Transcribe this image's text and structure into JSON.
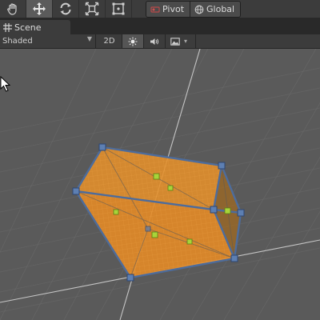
{
  "toolbar": {
    "tools": [
      {
        "name": "hand-tool",
        "icon": "hand-icon",
        "active": false
      },
      {
        "name": "move-tool",
        "icon": "move-arrows-icon",
        "active": true
      },
      {
        "name": "rotate-tool",
        "icon": "rotate-icon",
        "active": false
      },
      {
        "name": "scale-tool",
        "icon": "scale-icon",
        "active": false
      },
      {
        "name": "rect-tool",
        "icon": "rect-transform-icon",
        "active": false
      }
    ],
    "pivot_label": "Pivot",
    "global_label": "Global"
  },
  "scene_tab": {
    "label": "Scene",
    "icon": "grid-icon"
  },
  "scene_toolbar": {
    "shading_mode": "Shaded",
    "mode_2d_label": "2D",
    "lighting_icon": "sun-icon",
    "audio_icon": "speaker-icon",
    "effects_icon": "image-icon"
  },
  "colors": {
    "accent_orange": "#e58f2a",
    "edge_blue": "#4d6c9c",
    "handle_green": "#a8d43a",
    "viewport_bg": "#5a5a5a"
  }
}
